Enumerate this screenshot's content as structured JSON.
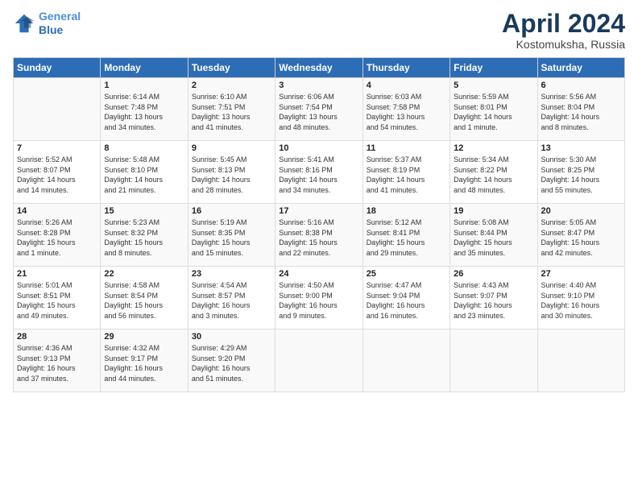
{
  "header": {
    "logo_line1": "General",
    "logo_line2": "Blue",
    "month_title": "April 2024",
    "location": "Kostomuksha, Russia"
  },
  "days_of_week": [
    "Sunday",
    "Monday",
    "Tuesday",
    "Wednesday",
    "Thursday",
    "Friday",
    "Saturday"
  ],
  "weeks": [
    [
      {
        "day": "",
        "content": ""
      },
      {
        "day": "1",
        "content": "Sunrise: 6:14 AM\nSunset: 7:48 PM\nDaylight: 13 hours\nand 34 minutes."
      },
      {
        "day": "2",
        "content": "Sunrise: 6:10 AM\nSunset: 7:51 PM\nDaylight: 13 hours\nand 41 minutes."
      },
      {
        "day": "3",
        "content": "Sunrise: 6:06 AM\nSunset: 7:54 PM\nDaylight: 13 hours\nand 48 minutes."
      },
      {
        "day": "4",
        "content": "Sunrise: 6:03 AM\nSunset: 7:58 PM\nDaylight: 13 hours\nand 54 minutes."
      },
      {
        "day": "5",
        "content": "Sunrise: 5:59 AM\nSunset: 8:01 PM\nDaylight: 14 hours\nand 1 minute."
      },
      {
        "day": "6",
        "content": "Sunrise: 5:56 AM\nSunset: 8:04 PM\nDaylight: 14 hours\nand 8 minutes."
      }
    ],
    [
      {
        "day": "7",
        "content": "Sunrise: 5:52 AM\nSunset: 8:07 PM\nDaylight: 14 hours\nand 14 minutes."
      },
      {
        "day": "8",
        "content": "Sunrise: 5:48 AM\nSunset: 8:10 PM\nDaylight: 14 hours\nand 21 minutes."
      },
      {
        "day": "9",
        "content": "Sunrise: 5:45 AM\nSunset: 8:13 PM\nDaylight: 14 hours\nand 28 minutes."
      },
      {
        "day": "10",
        "content": "Sunrise: 5:41 AM\nSunset: 8:16 PM\nDaylight: 14 hours\nand 34 minutes."
      },
      {
        "day": "11",
        "content": "Sunrise: 5:37 AM\nSunset: 8:19 PM\nDaylight: 14 hours\nand 41 minutes."
      },
      {
        "day": "12",
        "content": "Sunrise: 5:34 AM\nSunset: 8:22 PM\nDaylight: 14 hours\nand 48 minutes."
      },
      {
        "day": "13",
        "content": "Sunrise: 5:30 AM\nSunset: 8:25 PM\nDaylight: 14 hours\nand 55 minutes."
      }
    ],
    [
      {
        "day": "14",
        "content": "Sunrise: 5:26 AM\nSunset: 8:28 PM\nDaylight: 15 hours\nand 1 minute."
      },
      {
        "day": "15",
        "content": "Sunrise: 5:23 AM\nSunset: 8:32 PM\nDaylight: 15 hours\nand 8 minutes."
      },
      {
        "day": "16",
        "content": "Sunrise: 5:19 AM\nSunset: 8:35 PM\nDaylight: 15 hours\nand 15 minutes."
      },
      {
        "day": "17",
        "content": "Sunrise: 5:16 AM\nSunset: 8:38 PM\nDaylight: 15 hours\nand 22 minutes."
      },
      {
        "day": "18",
        "content": "Sunrise: 5:12 AM\nSunset: 8:41 PM\nDaylight: 15 hours\nand 29 minutes."
      },
      {
        "day": "19",
        "content": "Sunrise: 5:08 AM\nSunset: 8:44 PM\nDaylight: 15 hours\nand 35 minutes."
      },
      {
        "day": "20",
        "content": "Sunrise: 5:05 AM\nSunset: 8:47 PM\nDaylight: 15 hours\nand 42 minutes."
      }
    ],
    [
      {
        "day": "21",
        "content": "Sunrise: 5:01 AM\nSunset: 8:51 PM\nDaylight: 15 hours\nand 49 minutes."
      },
      {
        "day": "22",
        "content": "Sunrise: 4:58 AM\nSunset: 8:54 PM\nDaylight: 15 hours\nand 56 minutes."
      },
      {
        "day": "23",
        "content": "Sunrise: 4:54 AM\nSunset: 8:57 PM\nDaylight: 16 hours\nand 3 minutes."
      },
      {
        "day": "24",
        "content": "Sunrise: 4:50 AM\nSunset: 9:00 PM\nDaylight: 16 hours\nand 9 minutes."
      },
      {
        "day": "25",
        "content": "Sunrise: 4:47 AM\nSunset: 9:04 PM\nDaylight: 16 hours\nand 16 minutes."
      },
      {
        "day": "26",
        "content": "Sunrise: 4:43 AM\nSunset: 9:07 PM\nDaylight: 16 hours\nand 23 minutes."
      },
      {
        "day": "27",
        "content": "Sunrise: 4:40 AM\nSunset: 9:10 PM\nDaylight: 16 hours\nand 30 minutes."
      }
    ],
    [
      {
        "day": "28",
        "content": "Sunrise: 4:36 AM\nSunset: 9:13 PM\nDaylight: 16 hours\nand 37 minutes."
      },
      {
        "day": "29",
        "content": "Sunrise: 4:32 AM\nSunset: 9:17 PM\nDaylight: 16 hours\nand 44 minutes."
      },
      {
        "day": "30",
        "content": "Sunrise: 4:29 AM\nSunset: 9:20 PM\nDaylight: 16 hours\nand 51 minutes."
      },
      {
        "day": "",
        "content": ""
      },
      {
        "day": "",
        "content": ""
      },
      {
        "day": "",
        "content": ""
      },
      {
        "day": "",
        "content": ""
      }
    ]
  ]
}
